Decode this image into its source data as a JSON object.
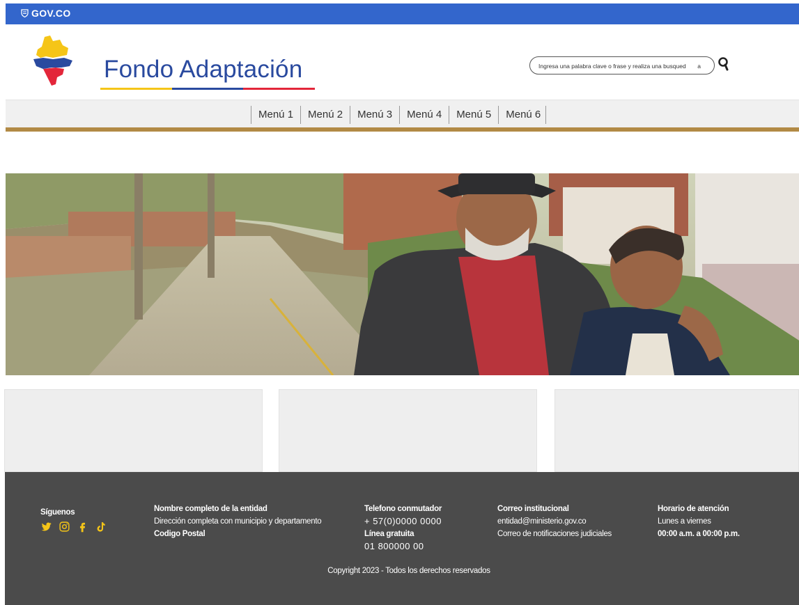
{
  "gov_bar": {
    "label": "GOV.CO",
    "color": "#3366cc"
  },
  "header": {
    "logo_text": "Fondo Adaptación",
    "logo_colors": [
      "#f5c518",
      "#2a4a9f",
      "#e3263a"
    ],
    "search": {
      "placeholder": "Ingresa una palabra clave o frase y realiza una busqued       a",
      "value": ""
    },
    "search_icon": "search-icon"
  },
  "nav": {
    "items": [
      "Menú 1",
      "Menú 2",
      "Menú 3",
      "Menú 4",
      "Menú 5",
      "Menú 6"
    ],
    "accent": "#b28a45"
  },
  "hero": {
    "image": "elderly-couple-rural-road-photo"
  },
  "footer": {
    "follow": {
      "title": "Síguenos",
      "icons": [
        "twitter-icon",
        "instagram-icon",
        "facebook-icon",
        "tiktok-icon"
      ],
      "icon_color": "#f5c518"
    },
    "entity": {
      "title": "Nombre completo de la entidad",
      "address": "Dirección completa con municipio y departamento",
      "postal": "Codigo Postal"
    },
    "phone": {
      "title": "Telefono conmutador",
      "number": "+ 57(0)0000 0000",
      "free_title": "Línea gratuita",
      "free_number": "01 800000 00"
    },
    "email": {
      "title": "Correo institucional",
      "address": "entidad@ministerio.gov.co",
      "judicial": "Correo de notificaciones judiciales"
    },
    "hours": {
      "title": "Horario de atención",
      "days": "Lunes a viernes",
      "time": "00:00 a.m. a 00:00 p.m."
    },
    "copyright": "Copyright 2023 - Todos los derechos reservados"
  }
}
